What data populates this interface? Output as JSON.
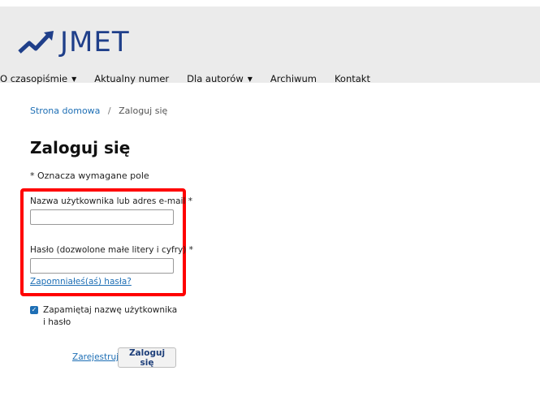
{
  "brand": {
    "name": "JMET",
    "color": "#1f3f8a"
  },
  "nav": {
    "items": [
      {
        "label": "O czasopiśmie",
        "has_dropdown": true
      },
      {
        "label": "Aktualny numer",
        "has_dropdown": false
      },
      {
        "label": "Dla autorów",
        "has_dropdown": true
      },
      {
        "label": "Archiwum",
        "has_dropdown": false
      },
      {
        "label": "Kontakt",
        "has_dropdown": false
      }
    ]
  },
  "breadcrumb": {
    "home": "Strona domowa",
    "separator": "/",
    "current": "Zaloguj się"
  },
  "page": {
    "title": "Zaloguj się",
    "required_note": "* Oznacza wymagane pole"
  },
  "form": {
    "username_label": "Nazwa użytkownika lub adres e-mail *",
    "username_value": "",
    "password_label": "Hasło (dozwolone małe litery i cyfry) *",
    "password_value": "",
    "forgot_link": "Zapomniałeś(aś) hasła?",
    "remember_label": "Zapamiętaj nazwę użytkownika i hasło",
    "remember_checked": true,
    "register_link": "Zarejestruj",
    "submit_label": "Zaloguj się"
  },
  "colors": {
    "header_bg": "#ebebeb",
    "link": "#1e6fb5",
    "highlight": "#ff0000"
  }
}
